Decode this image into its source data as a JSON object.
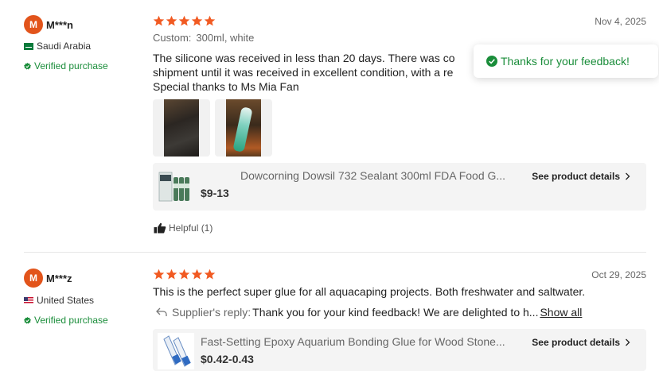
{
  "colors": {
    "star": "#f15a22",
    "avatar": "#e2541b",
    "verified": "#1a8d3a",
    "toast_text": "#1a8d3a"
  },
  "toast": {
    "icon": "check-circle-icon",
    "text": "Thanks for your feedback!"
  },
  "reviews": [
    {
      "avatar_letter": "M",
      "name": "M***n",
      "country": "Saudi Arabia",
      "verified": "Verified purchase",
      "rating": 5,
      "date": "Nov 4, 2025",
      "sku_label": "Custom:",
      "sku_value": "300ml, white",
      "text_lines": [
        "The silicone was received in less than 20 days. There was co",
        "shipment until it was received in excellent condition, with a re",
        "Special thanks to Ms Mia Fan"
      ],
      "photos": 2,
      "product": {
        "name": "Dowcorning Dowsil 732 Sealant 300ml FDA Food G...",
        "price": "$9-13",
        "details_label": "See product details"
      },
      "helpful_label": "Helpful (1)"
    },
    {
      "avatar_letter": "M",
      "name": "M***z",
      "country": "United States",
      "verified": "Verified purchase",
      "rating": 5,
      "date": "Oct 29, 2025",
      "text_lines": [
        "This is the perfect super glue for all aquacaping projects. Both freshwater and saltwater."
      ],
      "reply": {
        "label": "Supplier's reply:",
        "text": "Thank you for your kind feedback! We are delighted to h...",
        "show_all": "Show all"
      },
      "product": {
        "name": "Fast-Setting Epoxy Aquarium Bonding Glue for Wood Stone...",
        "price": "$0.42-0.43",
        "details_label": "See product details"
      }
    }
  ]
}
